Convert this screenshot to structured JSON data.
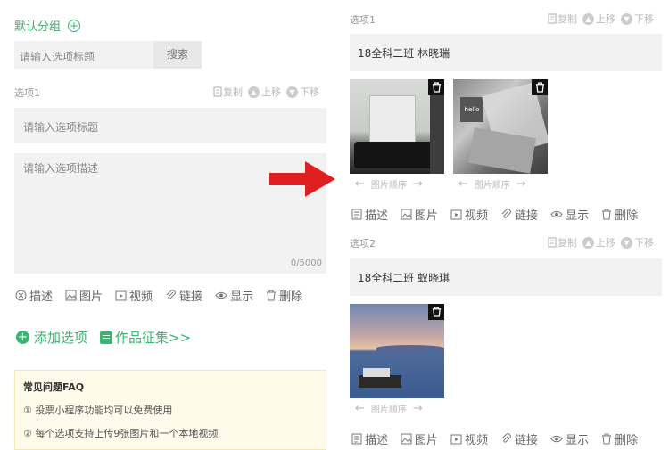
{
  "left": {
    "group_title": "默认分组",
    "title_search": {
      "placeholder": "请输入选项标题",
      "button": "搜索"
    },
    "option": {
      "label": "选项1",
      "copy": "复制",
      "up": "上移",
      "down": "下移",
      "title_placeholder": "请输入选项标题",
      "desc_placeholder": "请输入选项描述",
      "counter": "0/5000"
    },
    "actions": [
      "描述",
      "图片",
      "视频",
      "链接",
      "显示",
      "删除"
    ],
    "add_option": "添加选项",
    "collect": "作品征集>>",
    "faq": {
      "title": "常见问题FAQ",
      "items": [
        "① 投票小程序功能均可以免费使用",
        "② 每个选项支持上传9张图片和一个本地视频"
      ]
    }
  },
  "right": {
    "options": [
      {
        "label": "选项1",
        "title": "18全科二班 林晓瑞",
        "image_order": "图片顺序"
      },
      {
        "label": "选项2",
        "title": "18全科二班 蚁晓琪",
        "image_order": "图片顺序"
      }
    ],
    "copy": "复制",
    "up": "上移",
    "down": "下移",
    "actions": [
      "描述",
      "图片",
      "视频",
      "链接",
      "显示",
      "删除"
    ]
  },
  "colors": {
    "accent": "#3cb371",
    "arrow": "#e02020",
    "faq_bg": "#fffbea"
  }
}
